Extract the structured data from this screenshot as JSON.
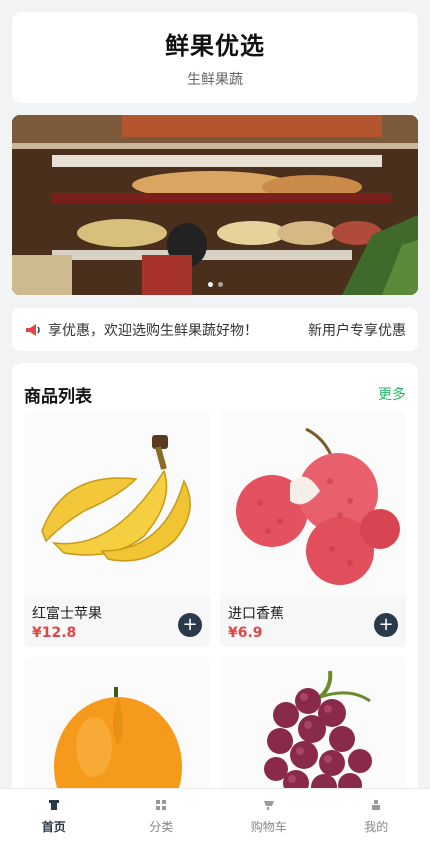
{
  "header": {
    "title": "鲜果优选",
    "subtitle": "生鲜果蔬"
  },
  "banner": {
    "image": "market-produce-stall",
    "dots": 2,
    "active_dot": 0
  },
  "notice": {
    "icon": "megaphone-icon",
    "text": "享优惠，欢迎选购生鲜果蔬好物！",
    "tag": "新用户专享优惠"
  },
  "products": {
    "title": "商品列表",
    "more": "更多",
    "items": [
      {
        "name": "红富士苹果",
        "price": "¥12.8",
        "image": "banana"
      },
      {
        "name": "进口香蕉",
        "price": "¥6.9",
        "image": "lychee"
      },
      {
        "name": "",
        "price": "",
        "image": "orange"
      },
      {
        "name": "",
        "price": "",
        "image": "grapes"
      }
    ],
    "add_label": "+"
  },
  "tabbar": {
    "items": [
      {
        "label": "首页",
        "icon": "home-icon",
        "active": true
      },
      {
        "label": "分类",
        "icon": "grid-icon",
        "active": false
      },
      {
        "label": "购物车",
        "icon": "cart-icon",
        "active": false
      },
      {
        "label": "我的",
        "icon": "user-icon",
        "active": false
      }
    ]
  },
  "colors": {
    "accent_green": "#2db56a",
    "price_red": "#e04646",
    "dark_button": "#2b3a4a"
  }
}
